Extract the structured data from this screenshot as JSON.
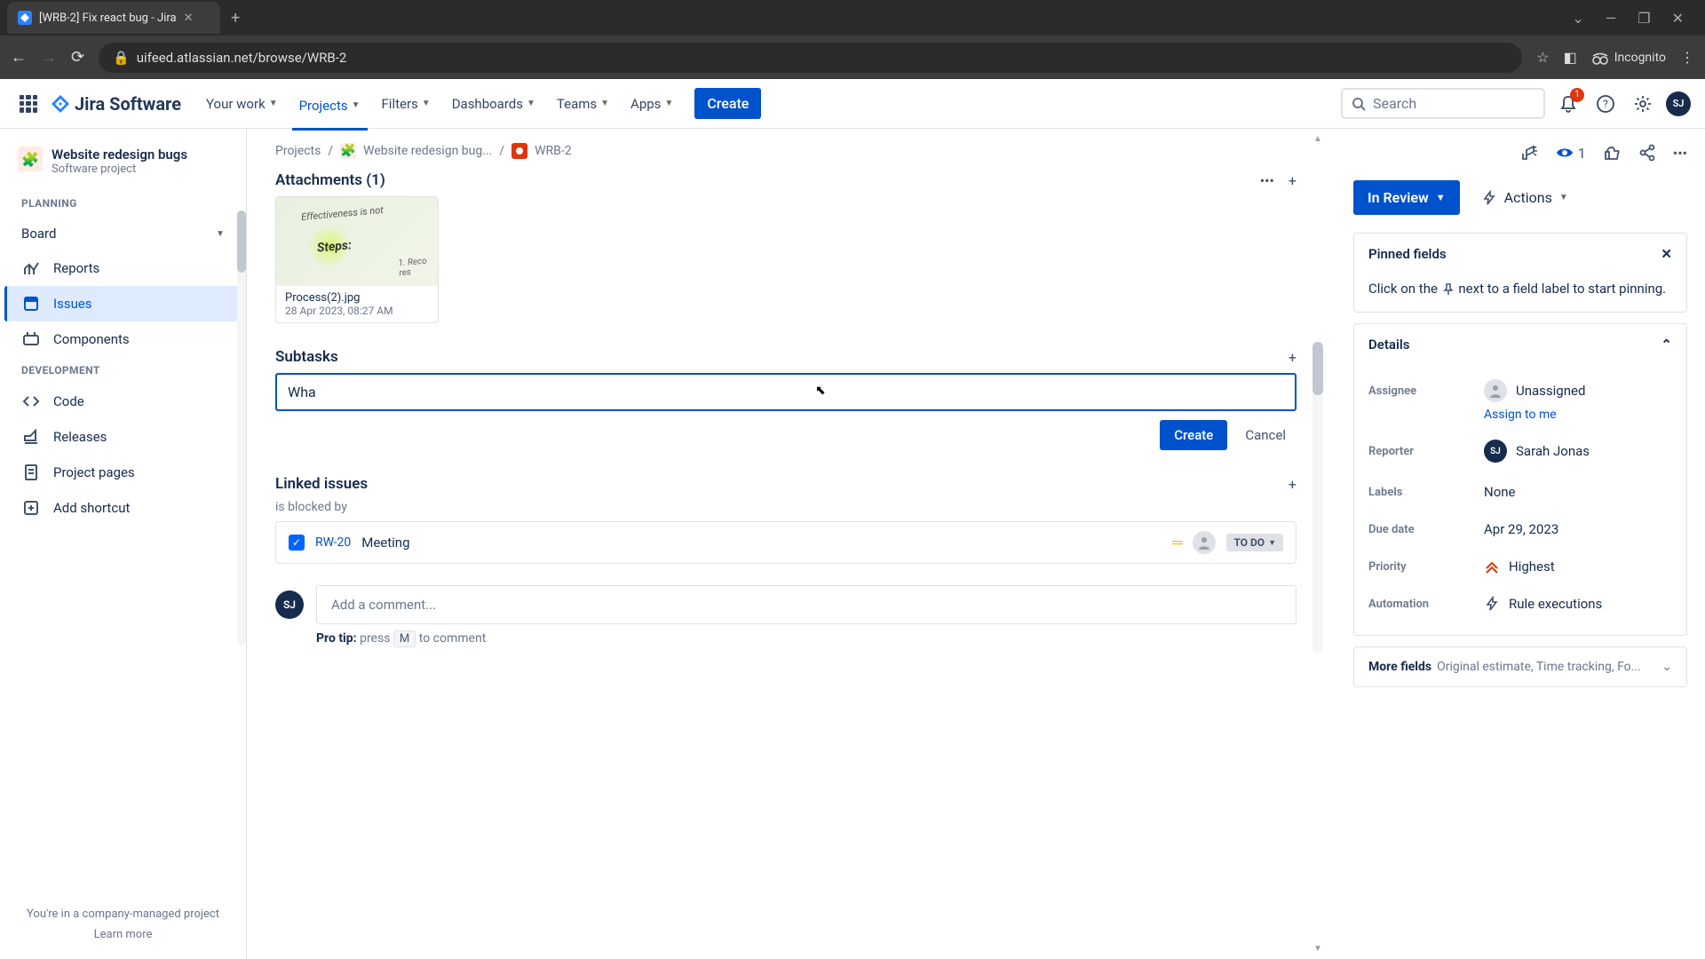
{
  "browser": {
    "tab_title": "[WRB-2] Fix react bug - Jira",
    "url": "uifeed.atlassian.net/browse/WRB-2",
    "incognito": "Incognito"
  },
  "header": {
    "product": "Jira Software",
    "nav": {
      "your_work": "Your work",
      "projects": "Projects",
      "filters": "Filters",
      "dashboards": "Dashboards",
      "teams": "Teams",
      "apps": "Apps"
    },
    "create": "Create",
    "search_placeholder": "Search",
    "notif_count": "1",
    "avatar_initials": "SJ"
  },
  "sidebar": {
    "project_name": "Website redesign bugs",
    "project_type": "Software project",
    "sections": {
      "planning": "PLANNING",
      "development": "DEVELOPMENT"
    },
    "items": {
      "board": "Board",
      "reports": "Reports",
      "issues": "Issues",
      "components": "Components",
      "code": "Code",
      "releases": "Releases",
      "project_pages": "Project pages",
      "add_shortcut": "Add shortcut"
    },
    "footer": {
      "managed": "You're in a company-managed project",
      "learn": "Learn more"
    }
  },
  "breadcrumb": {
    "projects": "Projects",
    "project": "Website redesign bug...",
    "key": "WRB-2"
  },
  "attachments": {
    "title": "Attachments (1)",
    "item": {
      "name": "Process(2).jpg",
      "date": "28 Apr 2023, 08:27 AM"
    }
  },
  "subtasks": {
    "title": "Subtasks",
    "input_value": "Wha",
    "create": "Create",
    "cancel": "Cancel"
  },
  "linked": {
    "title": "Linked issues",
    "relation": "is blocked by",
    "item": {
      "key": "RW-20",
      "title": "Meeting",
      "status": "TO DO"
    }
  },
  "comment": {
    "placeholder": "Add a comment...",
    "tip_label": "Pro tip:",
    "tip_press": "press",
    "tip_key": "M",
    "tip_rest": "to comment"
  },
  "right": {
    "watch_count": "1",
    "status": "In Review",
    "actions": "Actions",
    "pinned": {
      "title": "Pinned fields",
      "text_a": "Click on the",
      "text_b": "next to a field label to start pinning."
    },
    "details": {
      "title": "Details",
      "assignee": {
        "label": "Assignee",
        "value": "Unassigned",
        "assign": "Assign to me"
      },
      "reporter": {
        "label": "Reporter",
        "value": "Sarah Jonas",
        "initials": "SJ"
      },
      "labels": {
        "label": "Labels",
        "value": "None"
      },
      "due": {
        "label": "Due date",
        "value": "Apr 29, 2023"
      },
      "priority": {
        "label": "Priority",
        "value": "Highest"
      },
      "automation": {
        "label": "Automation",
        "value": "Rule executions"
      }
    },
    "more": {
      "label": "More fields",
      "hint": "Original estimate, Time tracking, Fo..."
    }
  }
}
